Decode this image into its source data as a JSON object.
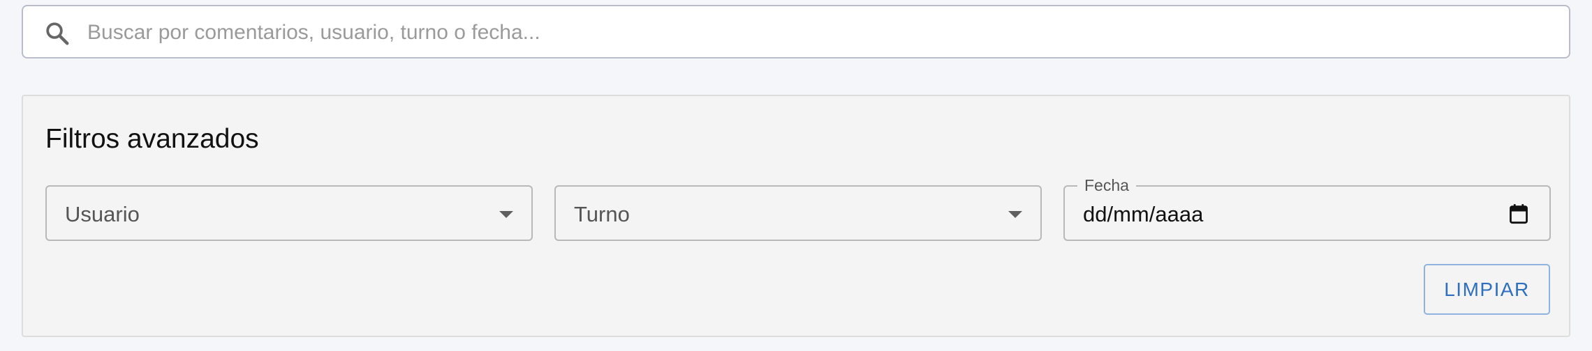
{
  "search": {
    "placeholder": "Buscar por comentarios, usuario, turno o fecha...",
    "value": "",
    "icon": "search-icon"
  },
  "filters": {
    "title": "Filtros avanzados",
    "usuario": {
      "label": "Usuario",
      "icon": "chevron-down-icon"
    },
    "turno": {
      "label": "Turno",
      "icon": "chevron-down-icon"
    },
    "fecha": {
      "legend": "Fecha",
      "value": "dd/mm/aaaa",
      "icon": "calendar-icon"
    },
    "clear_label": "LIMPIAR"
  },
  "colors": {
    "page_background": "#f4f6fa",
    "panel_background": "#f4f4f4",
    "accent": "#2f6fbf"
  }
}
